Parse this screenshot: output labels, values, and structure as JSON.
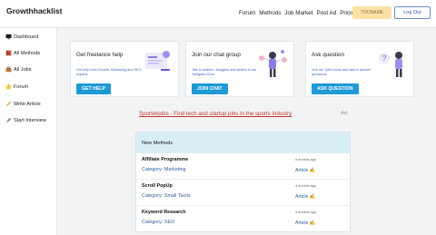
{
  "header": {
    "logo": "Growthhacklist",
    "nav": [
      "Forum",
      "Methods",
      "Job Market",
      "Post Ad",
      "Pricing"
    ],
    "user_button": "TOONAME",
    "logout_button": "Log Out"
  },
  "sidebar": {
    "items": [
      {
        "label": "Dashboard",
        "icon": "monitor-icon"
      },
      {
        "label": "All Methods",
        "icon": "book-icon"
      },
      {
        "label": "All Jobs",
        "icon": "briefcase-icon"
      },
      {
        "label": "Forum",
        "icon": "hand-icon"
      },
      {
        "label": "Write Article",
        "icon": "pencil-icon"
      },
      {
        "label": "Start Interview",
        "icon": "rocket-icon"
      }
    ]
  },
  "cards": [
    {
      "title": "Get freelance help",
      "description": "Get help from Growth, Marketing and SEO experts.",
      "button": "GET HELP"
    },
    {
      "title": "Join our chat group",
      "description": "Talk to makers, bloggers and writers in our Telegram Chat.",
      "button": "JOIN CHAT"
    },
    {
      "title": "Ask question",
      "description": "Join our Q&A forum and ask or answer questions.",
      "button": "ASK QUESTION"
    }
  ],
  "ad": {
    "link": "Sportekjobs - Find tech and startup jobs in the sports industry",
    "tag": "Ad"
  },
  "methods": {
    "heading": "New Methods",
    "rows": [
      {
        "title": "Affiliate Programme",
        "category": "Category: Marketing",
        "age": "5 months ago",
        "type": "Article ✍"
      },
      {
        "title": "Scroll PopUp",
        "category": "Category: Small Tactis",
        "age": "4 months ago",
        "type": "Article ✍"
      },
      {
        "title": "Keyword Research",
        "category": "Category: SEO",
        "age": "4 months ago",
        "type": "Article ✍"
      }
    ]
  },
  "colors": {
    "accent": "#1f9ad6",
    "methods_header": "#d8eef5",
    "user_button": "#fde2a8",
    "ad_link": "#c0392b"
  }
}
